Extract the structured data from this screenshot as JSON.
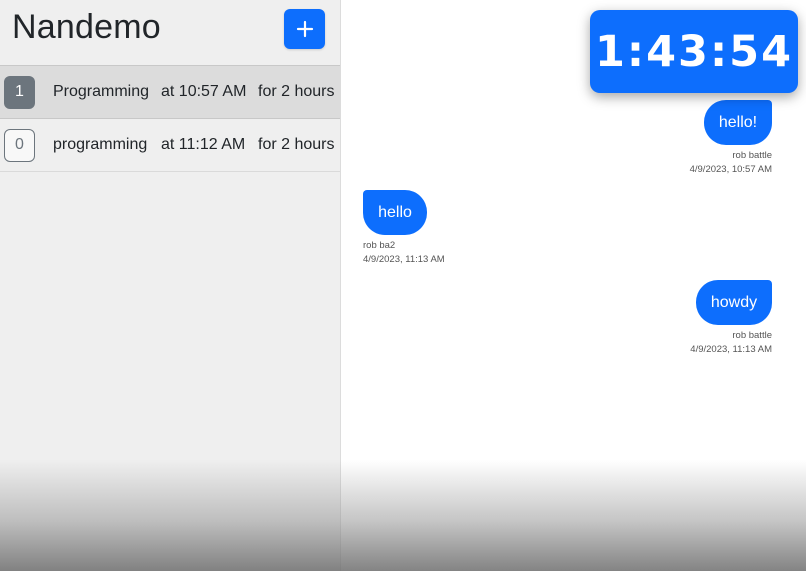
{
  "sidebar": {
    "title": "Nandemo",
    "add_button_icon": "plus-icon",
    "items": [
      {
        "count": "1",
        "name": "Programming",
        "time": "at 10:57 AM",
        "duration": "for 2 hours",
        "active": true
      },
      {
        "count": "0",
        "name": "programming",
        "time": "at 11:12 AM",
        "duration": "for 2 hours",
        "active": false
      }
    ]
  },
  "timer": {
    "display": "1:43:54"
  },
  "messages": [
    {
      "text": "hello!",
      "author": "rob battle",
      "timestamp": "4/9/2023, 10:57 AM",
      "side": "right"
    },
    {
      "text": "hello",
      "author": "rob ba2",
      "timestamp": "4/9/2023, 11:13 AM",
      "side": "left"
    },
    {
      "text": "howdy",
      "author": "rob battle",
      "timestamp": "4/9/2023, 11:13 AM",
      "side": "right"
    }
  ],
  "colors": {
    "accent": "#0d6efd",
    "badge_gray": "#6c757d",
    "sidebar_bg": "#efefef"
  }
}
